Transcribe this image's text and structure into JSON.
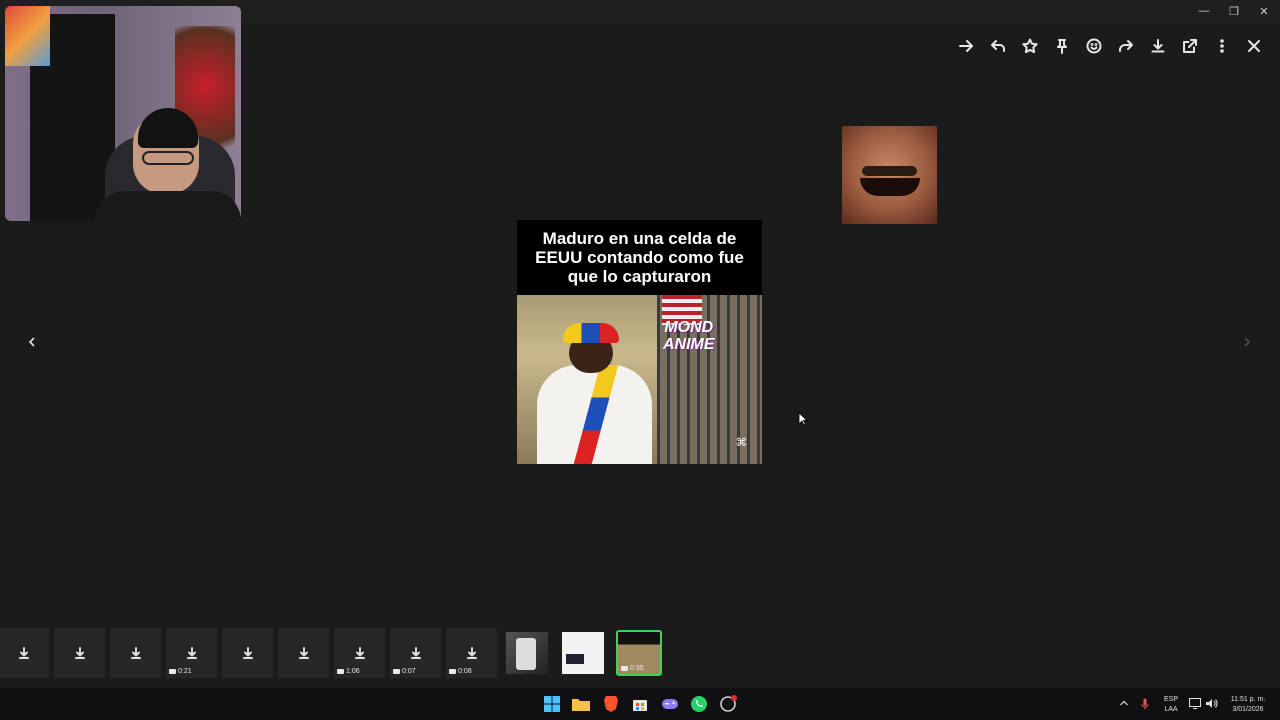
{
  "window": {
    "minimize_label": "—",
    "restore_label": "❐",
    "close_label": "✕"
  },
  "toolbar": {
    "icons": [
      "forward-icon",
      "reply-icon",
      "star-icon",
      "pin-icon",
      "emoji-icon",
      "share-icon",
      "download-icon",
      "open-external-icon",
      "more-icon",
      "close-icon"
    ]
  },
  "viewer": {
    "caption": "Maduro en una celda de EEUU contando como fue que lo capturaron",
    "watermark_line1": "MOND",
    "watermark_line2": "ANIME"
  },
  "strip": {
    "durations": [
      "0:21",
      "1:06",
      "0:07",
      "0:08",
      "0:35"
    ]
  },
  "taskbar": {
    "lang_top": "ESP",
    "lang_bottom": "LAA",
    "time": "11:51 p. m.",
    "date": "3/01/2026"
  },
  "colors": {
    "accent_selected": "#3fd15a",
    "background": "#1b1b1b"
  }
}
